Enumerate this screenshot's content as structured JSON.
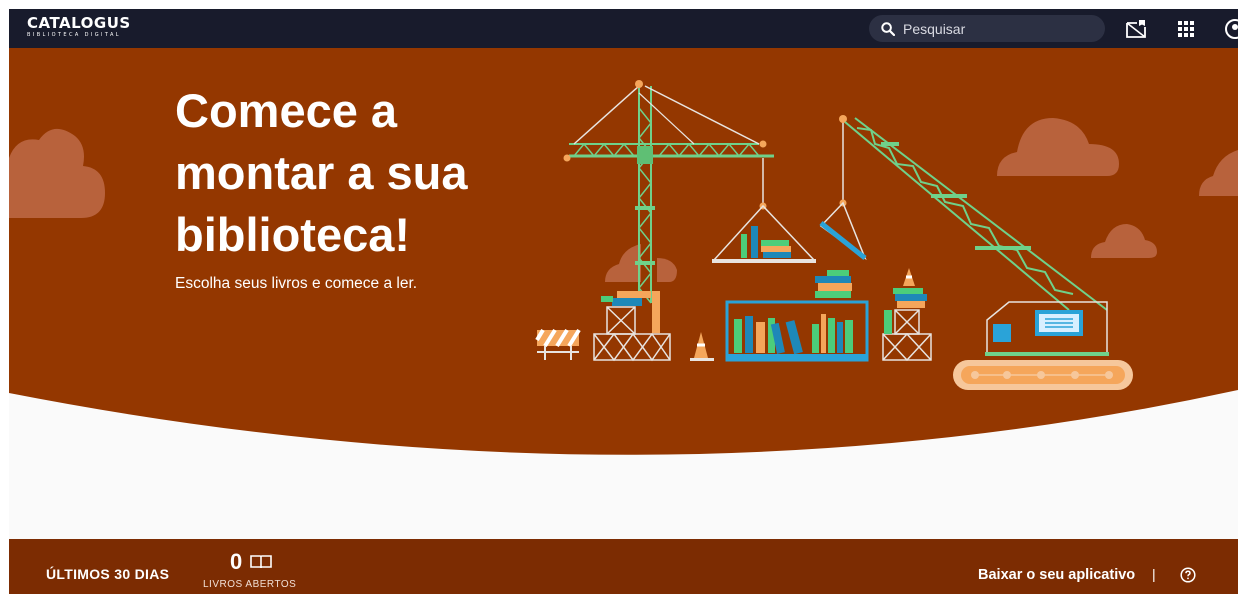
{
  "header": {
    "logo_text": "CATALOGUS",
    "logo_subtitle": "BIBLIOTECA DIGITAL",
    "search_placeholder": "Pesquisar",
    "icons": [
      "search-icon",
      "library-icon",
      "apps-grid-icon",
      "account-icon"
    ]
  },
  "hero": {
    "title_lines": [
      "Comece a",
      "montar a sua",
      "biblioteca!"
    ],
    "subtitle": "Escolha seus livros e comece a ler.",
    "colors": {
      "background": "#943700",
      "crane": "#5fbf74",
      "clouds": "#b8623c"
    }
  },
  "stats_bar": {
    "period_label": "ÚLTIMOS 30 DIAS",
    "books_opened_count": "0",
    "books_opened_label": "LIVROS ABERTOS",
    "download_app_label": "Baixar o seu aplicativo",
    "separator": "|",
    "icons": [
      "open-book-icon",
      "help-icon"
    ]
  },
  "colors": {
    "topbar": "#181b2c",
    "footer": "#7c2c02",
    "page": "#fafafa"
  }
}
